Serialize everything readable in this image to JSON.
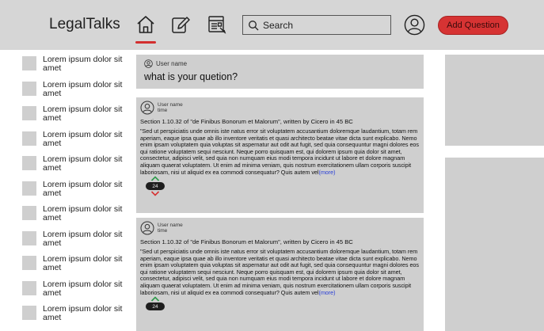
{
  "header": {
    "logo": "LegalTalks",
    "nav_icons": [
      "home-icon",
      "edit-icon",
      "article-icon"
    ],
    "search_placeholder": "Search",
    "add_question_label": "Add Question",
    "accent_color": "#d63333"
  },
  "sidebar": {
    "items": [
      {
        "label": "Lorem ipsum dolor sit amet"
      },
      {
        "label": "Lorem ipsum dolor sit amet"
      },
      {
        "label": "Lorem ipsum dolor sit amet"
      },
      {
        "label": "Lorem ipsum dolor sit amet"
      },
      {
        "label": "Lorem ipsum dolor sit amet"
      },
      {
        "label": "Lorem ipsum dolor sit amet"
      },
      {
        "label": "Lorem ipsum dolor sit amet"
      },
      {
        "label": "Lorem ipsum dolor sit amet"
      },
      {
        "label": "Lorem ipsum dolor sit amet"
      },
      {
        "label": "Lorem ipsum dolor sit amet"
      },
      {
        "label": "Lorem ipsum dolor sit amet"
      }
    ]
  },
  "ask": {
    "username": "User name",
    "prompt": "what is your quetion?"
  },
  "posts": [
    {
      "username": "User name",
      "time": "time",
      "title": "Section 1.10.32 of \"de Finibus Bonorum et Malorum\", written by Cicero in 45 BC",
      "body": "\"Sed ut perspiciatis unde omnis iste natus error sit voluptatem accusantium doloremque laudantium, totam rem aperiam, eaque ipsa quae ab illo inventore veritatis et quasi architecto beatae vitae dicta sunt explicabo. Nemo enim ipsam voluptatem quia voluptas sit aspernatur aut odit aut fugit, sed quia consequuntur magni dolores eos qui ratione voluptatem sequi nesciunt. Neque porro quisquam est, qui dolorem ipsum quia dolor sit amet, consectetur, adipisci velit, sed quia non numquam eius modi tempora incidunt ut labore et dolore magnam aliquam quaerat voluptatem. Ut enim ad minima veniam, quis nostrum exercitationem ullam corporis suscipit laboriosam, nisi ut aliquid ex ea commodi consequatur? Quis autem vel",
      "more_label": "(more)",
      "votes": "24"
    },
    {
      "username": "User name",
      "time": "time",
      "title": "Section 1.10.32 of \"de Finibus Bonorum et Malorum\", written by Cicero in 45 BC",
      "body": "\"Sed ut perspiciatis unde omnis iste natus error sit voluptatem accusantium doloremque laudantium, totam rem aperiam, eaque ipsa quae ab illo inventore veritatis et quasi architecto beatae vitae dicta sunt explicabo. Nemo enim ipsam voluptatem quia voluptas sit aspernatur aut odit aut fugit, sed quia consequuntur magni dolores eos qui ratione voluptatem sequi nesciunt. Neque porro quisquam est, qui dolorem ipsum quia dolor sit amet, consectetur, adipisci velit, sed quia non numquam eius modi tempora incidunt ut labore et dolore magnam aliquam quaerat voluptatem. Ut enim ad minima veniam, quis nostrum exercitationem ullam corporis suscipit laboriosam, nisi ut aliquid ex ea commodi consequatur? Quis autem vel",
      "more_label": "(more)",
      "votes": "24"
    }
  ]
}
